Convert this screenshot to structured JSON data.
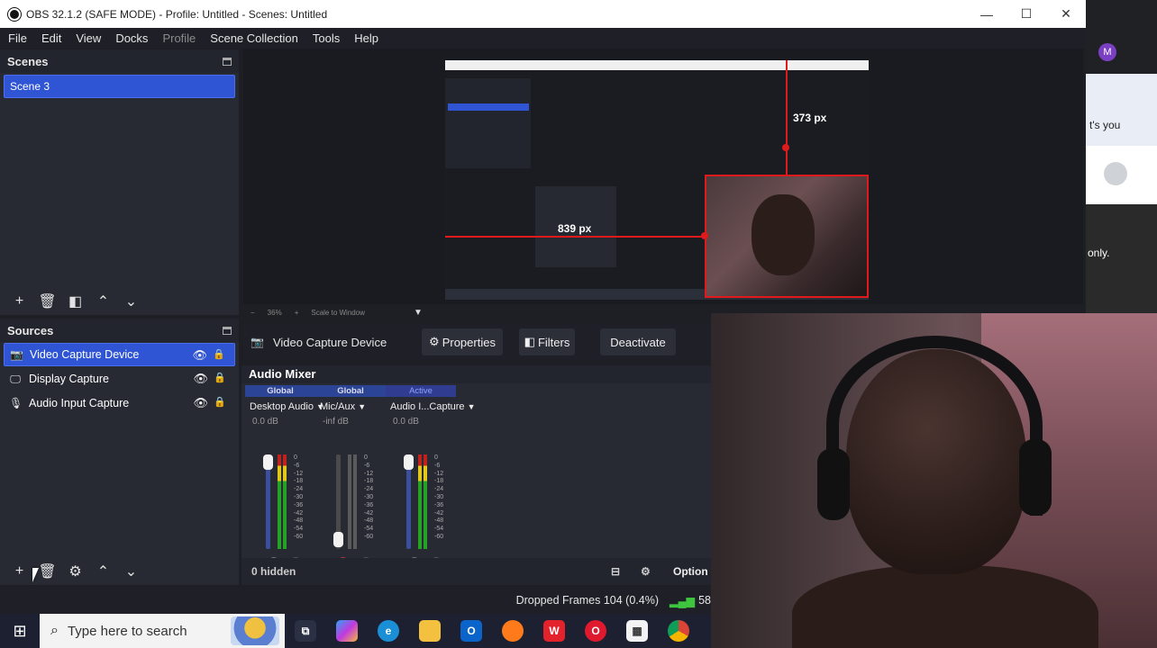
{
  "window": {
    "title": "OBS 32.1.2 (SAFE MODE) - Profile: Untitled - Scenes: Untitled",
    "minimize": "—",
    "maximize": "☐",
    "close": "✕"
  },
  "menu": [
    "File",
    "Edit",
    "View",
    "Docks",
    "Profile",
    "Scene Collection",
    "Tools",
    "Help"
  ],
  "scenes": {
    "header": "Scenes",
    "items": [
      "Scene 3"
    ]
  },
  "sources": {
    "header": "Sources",
    "items": [
      {
        "label": "Video Capture Device",
        "icon": "camera-icon"
      },
      {
        "label": "Display Capture",
        "icon": "monitor-icon"
      },
      {
        "label": "Audio Input Capture",
        "icon": "microphone-icon"
      }
    ]
  },
  "preview": {
    "measure_v": "373 px",
    "measure_h": "839 px",
    "zoom": "36%",
    "scale_mode": "Scale to Window"
  },
  "source_toolbar": {
    "name": "Video Capture Device",
    "properties": "Properties",
    "filters": "Filters",
    "deactivate": "Deactivate"
  },
  "mixer": {
    "header": "Audio Mixer",
    "channels": [
      {
        "badge": "Global",
        "name": "Desktop Audio",
        "db": "0.0 dB",
        "level": 0.95,
        "muted": false
      },
      {
        "badge": "Global",
        "name": "Mic/Aux",
        "db": "-inf dB",
        "level": 0.1,
        "muted": true
      },
      {
        "badge": "Active",
        "name": "Audio I...Capture",
        "db": "0.0 dB",
        "level": 0.95,
        "muted": false
      }
    ],
    "ticks": [
      "0",
      "-6",
      "-12",
      "-18",
      "-24",
      "-30",
      "-36",
      "-42",
      "-48",
      "-54",
      "-60"
    ],
    "hidden": "0 hidden",
    "options": "Option"
  },
  "status": {
    "dropped": "Dropped Frames 104 (0.4%)",
    "fps_partial": "58"
  },
  "taskbar": {
    "search_placeholder": "Type here to search"
  },
  "chrome": {
    "avatar_letter": "M",
    "snippet1": "t's you",
    "snippet2": "only."
  },
  "colors": {
    "accent": "#2f55d4",
    "guide_red": "#e01a1a"
  }
}
